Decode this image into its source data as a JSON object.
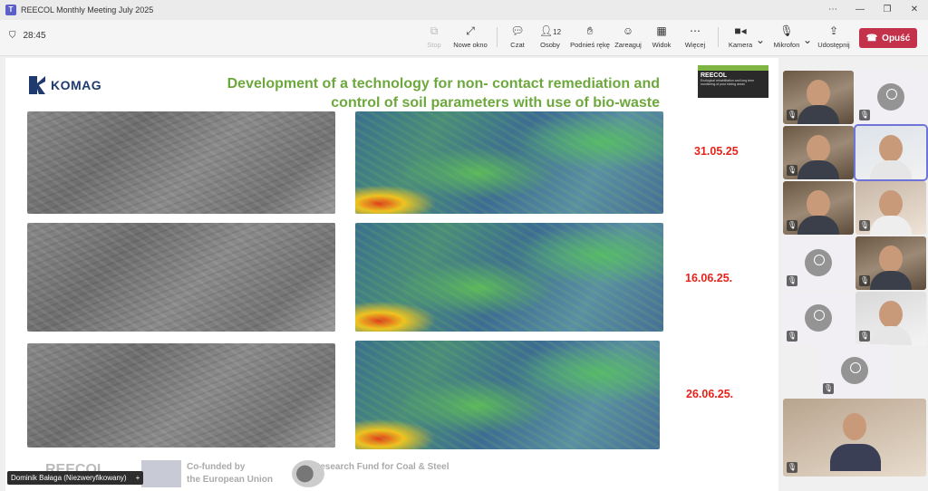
{
  "window": {
    "title": "REECOL Monthly Meeting July 2025"
  },
  "meeting": {
    "timer": "28:45"
  },
  "toolbar": {
    "stop_label": "Stop",
    "new_window_label": "Nowe okno",
    "chat_label": "Czat",
    "people_label": "Osoby",
    "people_count": "12",
    "raise_hand_label": "Podnieś rękę",
    "react_label": "Zareaguj",
    "view_label": "Widok",
    "more_label": "Więcej",
    "camera_label": "Kamera",
    "mic_label": "Mikrofon",
    "share_label": "Udostępnij",
    "leave_label": "Opuść"
  },
  "slide": {
    "logo_text": "KOMAG",
    "title_line1": "Development of a technology for non- contact remediation and",
    "title_line2": "control of soil parameters with use of bio-waste",
    "reecol_badge": "REECOL",
    "reecol_sub": "Ecological rehabilitation and long term monitoring of post mining areas",
    "dates": [
      "31.05.25",
      "16.06.25.",
      "26.06.25."
    ],
    "footer": {
      "reecol": "REECOL",
      "cofunded_line1": "Co-funded by",
      "cofunded_line2": "the European Union",
      "rfcs": "Research Fund for Coal & Steel"
    }
  },
  "presenter": {
    "name": "Dominik Bałaga (Niezweryfikowany)"
  },
  "colors": {
    "accent": "#5b5fc7",
    "leave": "#c4314b",
    "title_green": "#6da83c",
    "date_red": "#e8221b"
  }
}
